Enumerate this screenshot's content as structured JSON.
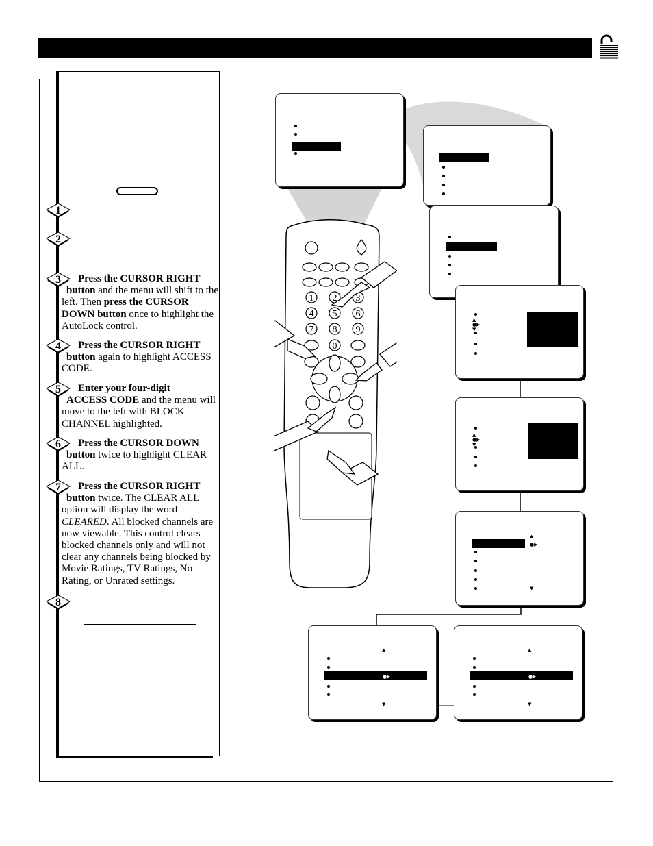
{
  "header": {
    "icon": "unlocked-padlock-icon"
  },
  "steps": [
    {
      "number": "1"
    },
    {
      "number": "2"
    },
    {
      "number": "3",
      "bold1": "Press the CURSOR RIGHT",
      "bold2": "button",
      "text1": " and the menu will shift to the left. Then ",
      "bold3": "press the CURSOR DOWN button",
      "text2": " once to highlight the AutoLock control."
    },
    {
      "number": "4",
      "bold1": "Press the CURSOR RIGHT",
      "bold2": "button",
      "text1": " again to highlight ACCESS CODE."
    },
    {
      "number": "5",
      "bold1": "Enter your four-digit",
      "bold2": "ACCESS CODE",
      "text1": " and the menu will move to the left with BLOCK CHANNEL highlighted."
    },
    {
      "number": "6",
      "bold1": "Press the CURSOR DOWN",
      "bold2": "button",
      "text1": " twice to highlight CLEAR ALL."
    },
    {
      "number": "7",
      "bold1": "Press the CURSOR RIGHT",
      "bold2": "button",
      "text1": " twice. The CLEAR ALL option will display the word ",
      "italic": "CLEARED",
      "text2": ". All blocked channels are now viewable. This control clears blocked channels only and will not clear any channels being blocked by Movie Ratings, TV Ratings, No Rating, or Unrated settings."
    },
    {
      "number": "8"
    }
  ],
  "remote": {
    "number_keys": [
      "1",
      "2",
      "3",
      "4",
      "5",
      "6",
      "7",
      "8",
      "9",
      "0"
    ],
    "icons": [
      "power-icon",
      "plus-icon",
      "minus-icon",
      "rewind-icon",
      "stop-icon",
      "play-icon",
      "fast-forward-icon",
      "pause-icon"
    ]
  },
  "colors": {
    "ink": "#000000",
    "swoosh": "#d9d9d9",
    "paper": "#ffffff"
  }
}
